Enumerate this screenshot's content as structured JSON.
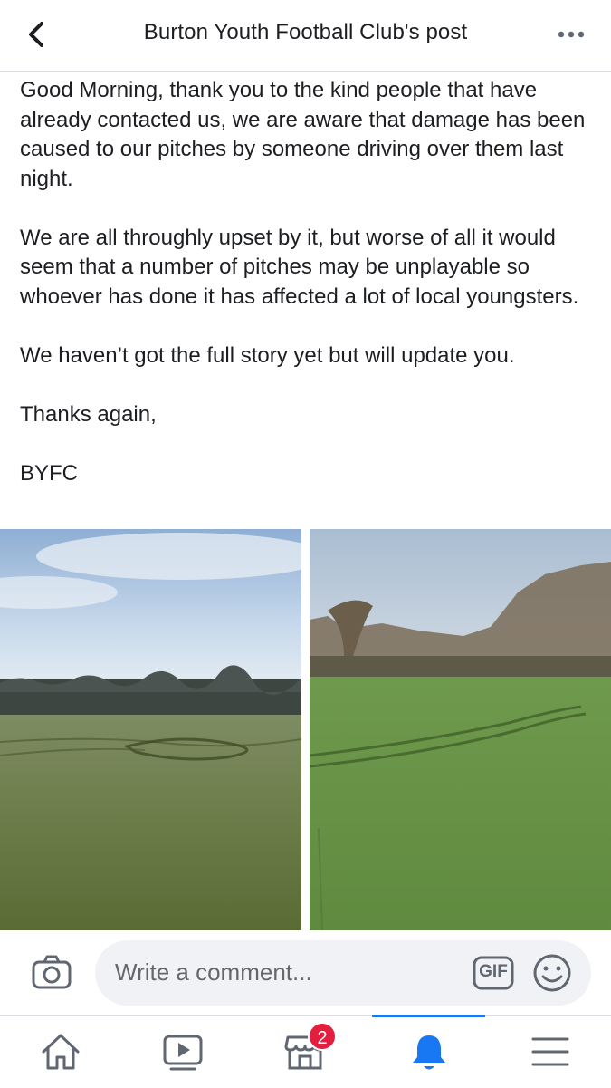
{
  "header": {
    "title": "Burton Youth Football Club's post"
  },
  "post": {
    "paragraphs": [
      "Good Morning, thank you to the kind people that have already contacted us, we are aware that damage has been caused to our pitches by someone driving over them last night.",
      "We are all throughly upset by it, but worse of all it would seem that a number of pitches may be unplayable so whoever has done it has affected a lot of local youngsters.",
      "We haven’t got the full story yet but will update you.",
      "Thanks again,",
      "BYFC"
    ]
  },
  "comment": {
    "placeholder": "Write a comment...",
    "gif_label": "GIF"
  },
  "nav": {
    "items": [
      {
        "name": "home",
        "icon": "home-icon"
      },
      {
        "name": "watch",
        "icon": "video-play-icon"
      },
      {
        "name": "marketplace",
        "icon": "shop-icon",
        "badge": "2"
      },
      {
        "name": "notifications",
        "icon": "bell-icon",
        "active": true
      },
      {
        "name": "menu",
        "icon": "hamburger-menu-icon"
      }
    ]
  },
  "colors": {
    "accent": "#1877f2",
    "badge": "#e41e3f",
    "icon": "#606770",
    "input_bg": "#f0f2f5"
  }
}
